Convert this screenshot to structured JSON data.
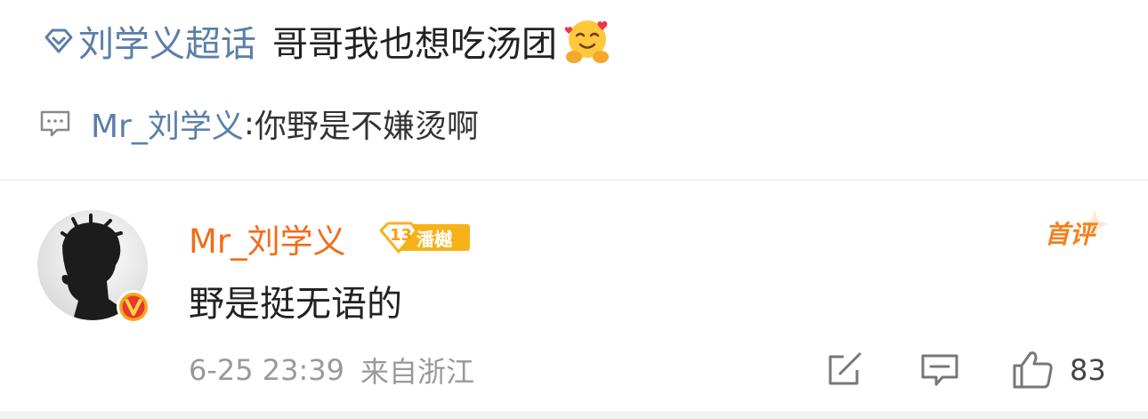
{
  "post": {
    "topic": "刘学义超话",
    "text": "哥哥我也想吃汤团"
  },
  "quote": {
    "user": "Mr_刘学义",
    "separator": ":",
    "text": " 你野是不嫌烫啊"
  },
  "comment": {
    "username": "Mr_刘学义",
    "level_badge": "潘樾",
    "level_number": "13",
    "first_comment_label": "首评",
    "text": "野是挺无语的",
    "date": "6-25 23:39",
    "location": "来自浙江",
    "like_count": "83"
  },
  "colors": {
    "link": "#5a7fa8",
    "username": "#f26c1a",
    "badge": "#f7b21a",
    "verified": "#f6a51b"
  },
  "icons": [
    "diamond-icon",
    "hugging-face-emoji",
    "quote-comment-icon",
    "verified-v-icon",
    "repost-icon",
    "comment-icon",
    "thumbs-up-icon"
  ]
}
